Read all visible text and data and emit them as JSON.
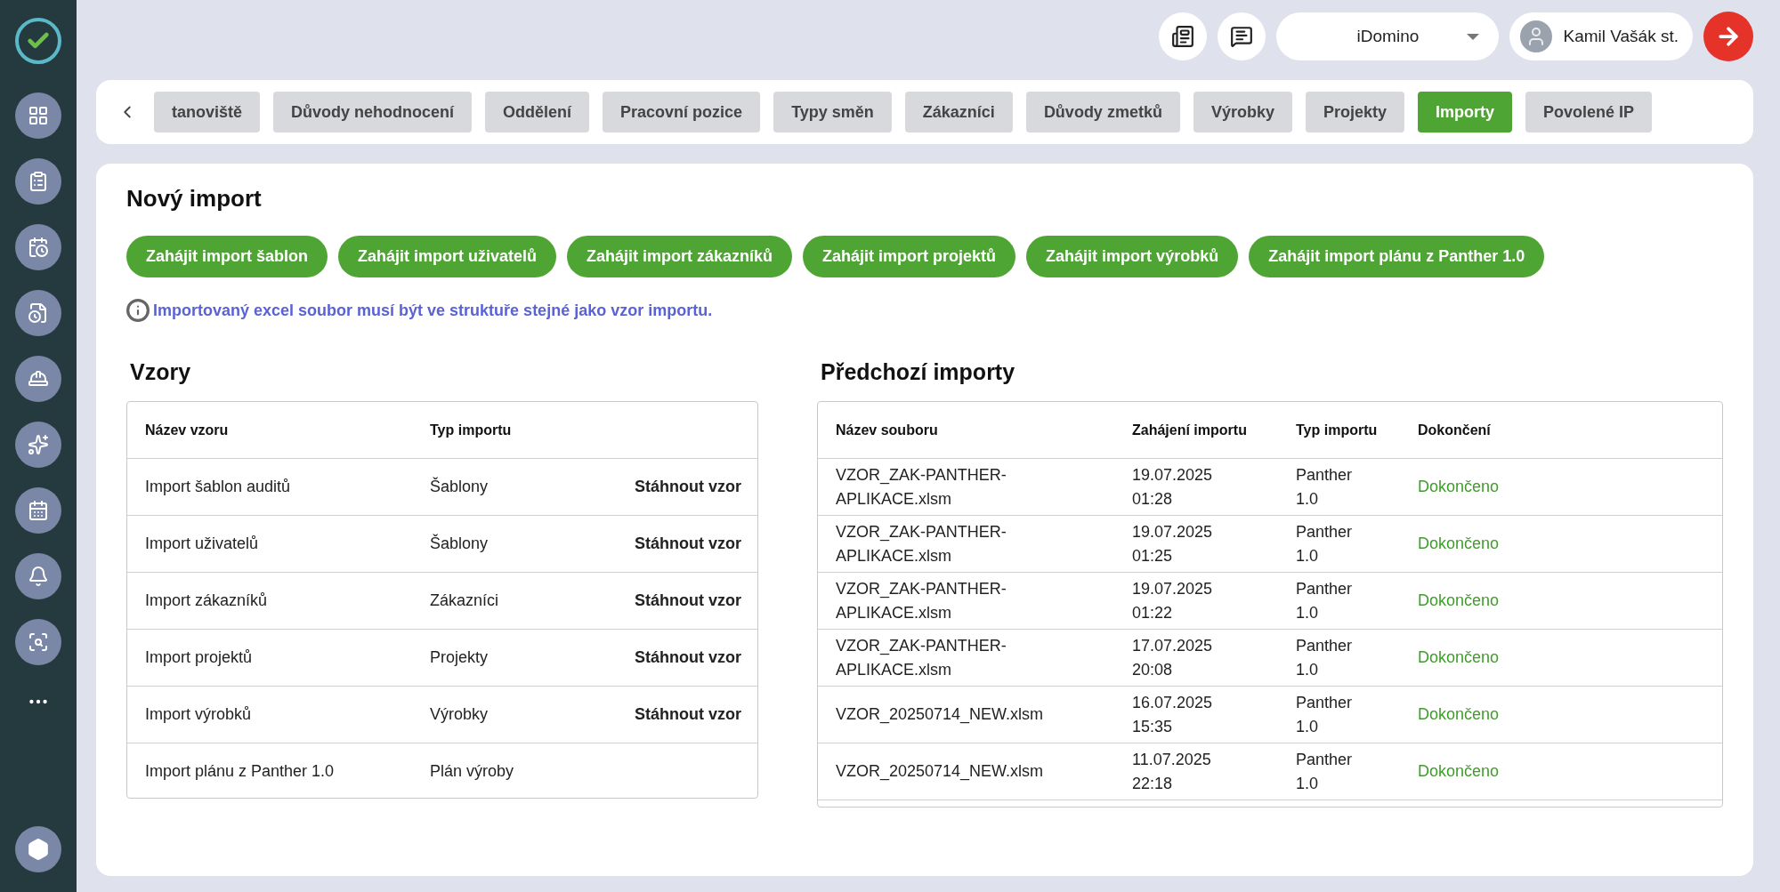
{
  "header": {
    "workspace": "iDomino",
    "user": "Kamil Vašák st."
  },
  "tabs": [
    {
      "label": "tanoviště",
      "selected": false
    },
    {
      "label": "Důvody nehodnocení",
      "selected": false
    },
    {
      "label": "Oddělení",
      "selected": false
    },
    {
      "label": "Pracovní pozice",
      "selected": false
    },
    {
      "label": "Typy směn",
      "selected": false
    },
    {
      "label": "Zákazníci",
      "selected": false
    },
    {
      "label": "Důvody zmetků",
      "selected": false
    },
    {
      "label": "Výrobky",
      "selected": false
    },
    {
      "label": "Projekty",
      "selected": false
    },
    {
      "label": "Importy",
      "selected": true
    },
    {
      "label": "Povolené IP",
      "selected": false
    }
  ],
  "new_import": {
    "title": "Nový import",
    "buttons": [
      "Zahájit import šablon",
      "Zahájit import uživatelů",
      "Zahájit import zákazníků",
      "Zahájit import projektů",
      "Zahájit import výrobků",
      "Zahájit import plánu z Panther 1.0"
    ],
    "info": "Importovaný excel soubor musí být ve struktuře stejné jako vzor importu."
  },
  "templates": {
    "title": "Vzory",
    "columns": [
      "Název vzoru",
      "Typ importu"
    ],
    "rows": [
      {
        "name": "Import šablon auditů",
        "type": "Šablony",
        "action": "Stáhnout vzor"
      },
      {
        "name": "Import uživatelů",
        "type": "Šablony",
        "action": "Stáhnout vzor"
      },
      {
        "name": "Import zákazníků",
        "type": "Zákazníci",
        "action": "Stáhnout vzor"
      },
      {
        "name": "Import projektů",
        "type": "Projekty",
        "action": "Stáhnout vzor"
      },
      {
        "name": "Import výrobků",
        "type": "Výrobky",
        "action": "Stáhnout vzor"
      },
      {
        "name": "Import plánu z Panther 1.0",
        "type": "Plán výroby"
      }
    ]
  },
  "previous": {
    "title": "Předchozí importy",
    "columns": [
      "Název souboru",
      "Zahájení importu",
      "Typ importu",
      "Dokončení"
    ],
    "rows": [
      {
        "file": "VZOR_ZAK-PANTHER-APLIKACE.xlsm",
        "started": "19.07.2025 01:28",
        "type": "Panther 1.0",
        "status": "Dokončeno"
      },
      {
        "file": "VZOR_ZAK-PANTHER-APLIKACE.xlsm",
        "started": "19.07.2025 01:25",
        "type": "Panther 1.0",
        "status": "Dokončeno"
      },
      {
        "file": "VZOR_ZAK-PANTHER-APLIKACE.xlsm",
        "started": "19.07.2025 01:22",
        "type": "Panther 1.0",
        "status": "Dokončeno"
      },
      {
        "file": "VZOR_ZAK-PANTHER-APLIKACE.xlsm",
        "started": "17.07.2025 20:08",
        "type": "Panther 1.0",
        "status": "Dokončeno"
      },
      {
        "file": "VZOR_20250714_NEW.xlsm",
        "started": "16.07.2025 15:35",
        "type": "Panther 1.0",
        "status": "Dokončeno"
      },
      {
        "file": "VZOR_20250714_NEW.xlsm",
        "started": "11.07.2025 22:18",
        "type": "Panther 1.0",
        "status": "Dokončeno"
      }
    ]
  }
}
